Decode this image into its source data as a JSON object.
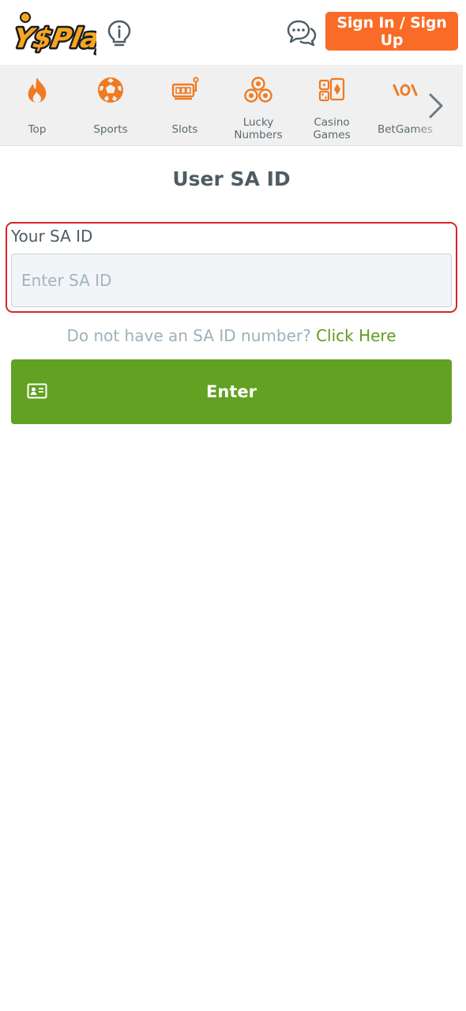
{
  "header": {
    "logo_text": "YesPlay",
    "signin_label": "Sign In / Sign Up"
  },
  "categories": [
    {
      "label": "Top",
      "icon": "fire-icon"
    },
    {
      "label": "Sports",
      "icon": "soccer-ball-icon"
    },
    {
      "label": "Slots",
      "icon": "slot-machine-icon"
    },
    {
      "label": "Lucky Numbers",
      "line1": "Lucky",
      "line2": "Numbers",
      "icon": "lottery-balls-icon"
    },
    {
      "label": "Casino Games",
      "line1": "Casino",
      "line2": "Games",
      "icon": "casino-cards-icon"
    },
    {
      "label": "BetGames",
      "icon": "betgames-icon"
    }
  ],
  "main": {
    "title": "User SA ID",
    "field_label": "Your SA ID",
    "field_placeholder": "Enter SA ID",
    "no_id_text": "Do not have an SA ID number?",
    "no_id_link": "Click Here",
    "enter_label": "Enter"
  },
  "colors": {
    "accent_orange": "#f96b26",
    "primary_green": "#62a121",
    "link_green": "#5f9c1d",
    "highlight_red": "#d8232a",
    "icon_orange": "#f07a21"
  }
}
